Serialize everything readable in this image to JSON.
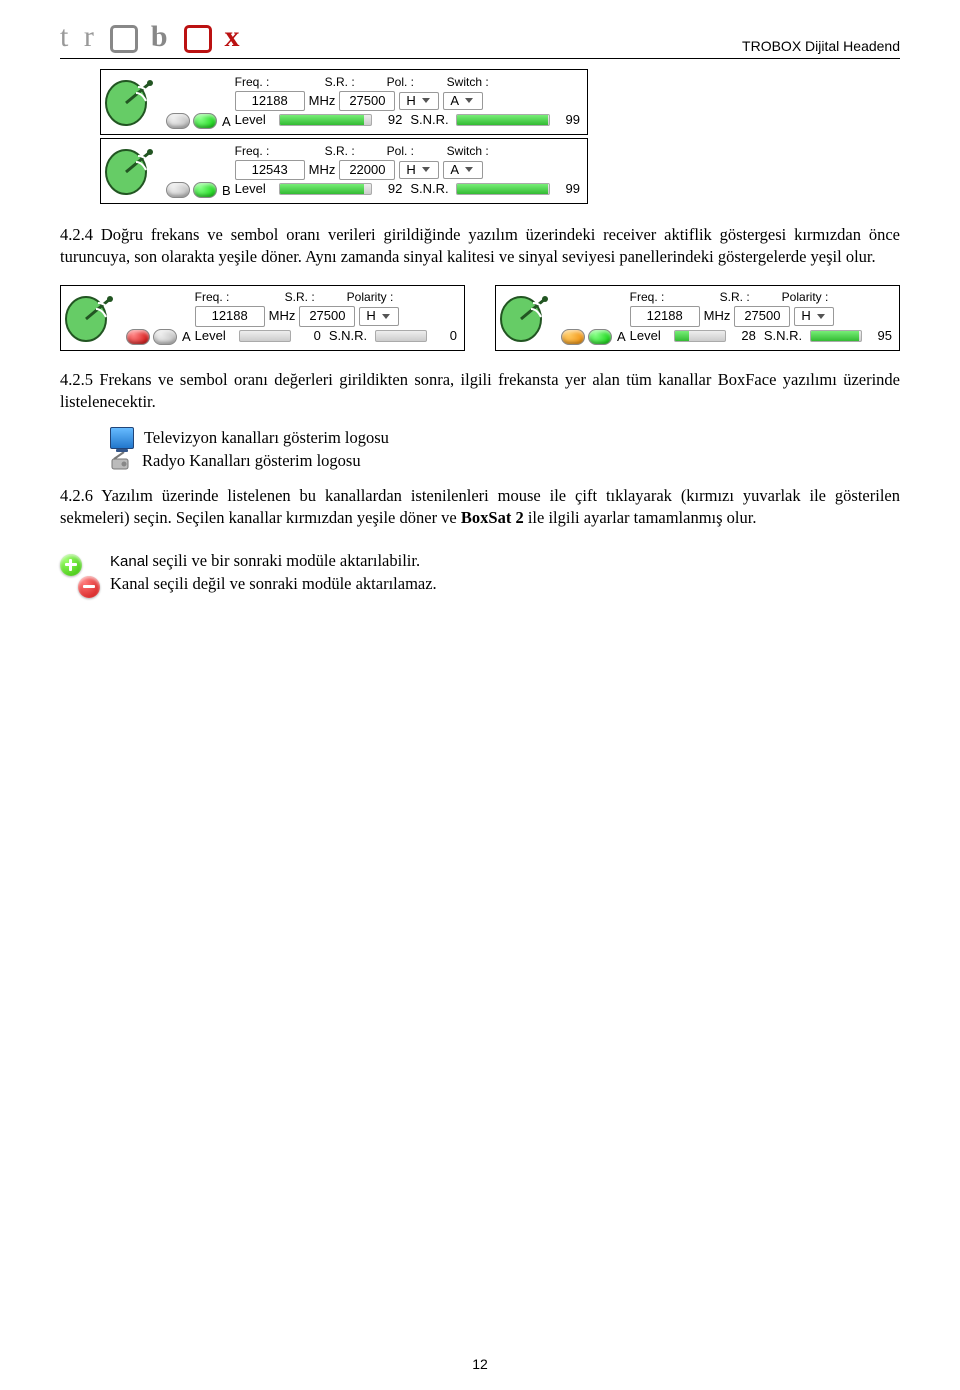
{
  "header": {
    "logo_text": "trobox",
    "doc_title": "TROBOX Dijital Headend"
  },
  "panel_labels": {
    "freq": "Freq. :",
    "sr": "S.R. :",
    "pol": "Pol. :",
    "polarity": "Polarity :",
    "switch": "Switch :",
    "mhz": "MHz",
    "level": "Level",
    "snr": "S.N.R."
  },
  "upper_panels": [
    {
      "channel": "A",
      "freq": "12188",
      "sr": "27500",
      "pol": "H",
      "switch": "A",
      "level": "92",
      "snr": "99",
      "level_pct": 92,
      "snr_pct": 99,
      "led1": "off",
      "led2": "green"
    },
    {
      "channel": "B",
      "freq": "12543",
      "sr": "22000",
      "pol": "H",
      "switch": "A",
      "level": "92",
      "snr": "99",
      "level_pct": 92,
      "snr_pct": 99,
      "led1": "off",
      "led2": "green"
    }
  ],
  "lower_panels": [
    {
      "channel": "A",
      "freq": "12188",
      "sr": "27500",
      "pol": "H",
      "level": "0",
      "snr": "0",
      "level_pct": 0,
      "snr_pct": 0,
      "led1": "red",
      "led2": "off"
    },
    {
      "channel": "A",
      "freq": "12188",
      "sr": "27500",
      "pol": "H",
      "level": "28",
      "snr": "95",
      "level_pct": 28,
      "snr_pct": 95,
      "led1": "orange",
      "led2": "green"
    }
  ],
  "text": {
    "p424": "4.2.4 Doğru frekans ve sembol oranı verileri girildiğinde yazılım üzerindeki receiver aktiflik göstergesi kırmızdan önce turuncuya, son olarakta yeşile döner. Aynı zamanda sinyal kalitesi ve sinyal seviyesi panellerindeki göstergelerde yeşil olur.",
    "p425": "4.2.5   Frekans ve sembol oranı değerleri girildikten sonra, ilgili frekansta yer alan tüm kanallar BoxFace yazılımı üzerinde listelenecektir.",
    "tv_line": "Televizyon kanalları gösterim logosu",
    "radio_line": "Radyo Kanalları gösterim logosu",
    "p426_a": "4.2.6   Yazılım üzerinde listelenen bu kanallardan istenilenleri mouse ile çift tıklayarak (kırmızı yuvarlak ile gösterilen sekmeleri) seçin. Seçilen kanallar kırmızdan yeşile döner ve ",
    "p426_bold": "BoxSat 2",
    "p426_b": " ile ilgili ayarlar tamamlanmış olur.",
    "pm_on": "Kanal seçili ve bir sonraki modüle aktarılabilir.",
    "pm_off": "Kanal seçili değil ve sonraki modüle aktarılamaz."
  },
  "page_number": "12"
}
